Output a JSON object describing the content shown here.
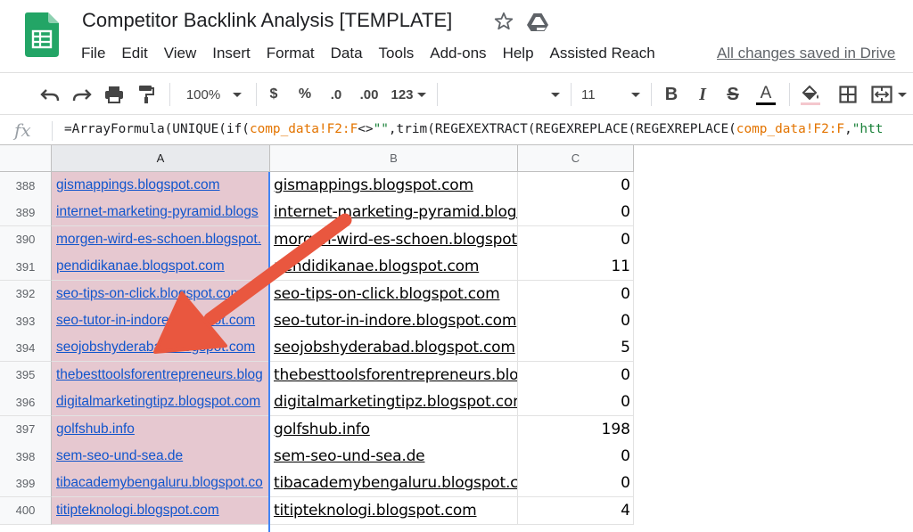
{
  "doc": {
    "title": "Competitor Backlink Analysis [TEMPLATE]",
    "save_status": "All changes saved in Drive"
  },
  "menu": [
    "File",
    "Edit",
    "View",
    "Insert",
    "Format",
    "Data",
    "Tools",
    "Add-ons",
    "Help",
    "Assisted Reach"
  ],
  "toolbar": {
    "zoom": "100%",
    "currency": "$",
    "percent": "%",
    "decrease_decimal": ".0",
    "increase_decimal": ".00",
    "more_formats": "123",
    "font_family": "",
    "font_size": "11",
    "bold": "B",
    "italic": "I",
    "strikethrough": "S",
    "text_color": "A"
  },
  "formula_bar": {
    "fx": "fx",
    "parts": [
      {
        "text": "=ArrayFormula(UNIQUE(if(",
        "kind": "plain"
      },
      {
        "text": "comp_data!F2:F",
        "kind": "ref"
      },
      {
        "text": "<>",
        "kind": "plain"
      },
      {
        "text": "\"\"",
        "kind": "str"
      },
      {
        "text": ",trim(REGEXEXTRACT(REGEXREPLACE(REGEXREPLACE(",
        "kind": "plain"
      },
      {
        "text": "comp_data!F2:F",
        "kind": "ref"
      },
      {
        "text": ",",
        "kind": "plain"
      },
      {
        "text": "\"htt",
        "kind": "str"
      }
    ]
  },
  "grid": {
    "columns": [
      "A",
      "B",
      "C"
    ],
    "rows": [
      {
        "num": "388",
        "a": "gismappings.blogspot.com",
        "b": "gismappings.blogspot.com",
        "c": "0"
      },
      {
        "num": "389",
        "a": "internet-marketing-pyramid.blogs",
        "b": "internet-marketing-pyramid.blogs",
        "c": "0"
      },
      {
        "num": "390",
        "a": "morgen-wird-es-schoen.blogspot.",
        "b": "morgen-wird-es-schoen.blogspot.",
        "c": "0"
      },
      {
        "num": "391",
        "a": "pendidikanae.blogspot.com",
        "b": "pendidikanae.blogspot.com",
        "c": "11"
      },
      {
        "num": "392",
        "a": "seo-tips-on-click.blogspot.com",
        "b": "seo-tips-on-click.blogspot.com",
        "c": "0"
      },
      {
        "num": "393",
        "a": "seo-tutor-in-indore.blogspot.com",
        "b": "seo-tutor-in-indore.blogspot.com",
        "c": "0"
      },
      {
        "num": "394",
        "a": "seojobshyderabad.blogspot.com",
        "b": "seojobshyderabad.blogspot.com",
        "c": "5"
      },
      {
        "num": "395",
        "a": "thebesttoolsforentrepreneurs.blog",
        "b": "thebesttoolsforentrepreneurs.blog",
        "c": "0"
      },
      {
        "num": "396",
        "a": "digitalmarketingtipz.blogspot.com",
        "b": "digitalmarketingtipz.blogspot.com",
        "c": "0"
      },
      {
        "num": "397",
        "a": "golfshub.info",
        "b": "golfshub.info",
        "c": "198"
      },
      {
        "num": "398",
        "a": "sem-seo-und-sea.de",
        "b": "sem-seo-und-sea.de",
        "c": "0"
      },
      {
        "num": "399",
        "a": "tibacademybengaluru.blogspot.co",
        "b": "tibacademybengaluru.blogspot.co",
        "c": "0"
      },
      {
        "num": "400",
        "a": "titipteknologi.blogspot.com",
        "b": "titipteknologi.blogspot.com",
        "c": "4"
      }
    ]
  },
  "colors": {
    "selected_column_fill": "#e6c8d0",
    "link_blue": "#1155cc",
    "annotation_arrow": "#e9573f",
    "formula_ref": "#e37400",
    "formula_string": "#188038"
  },
  "icons": [
    "sheets-logo",
    "star-icon",
    "drive-icon",
    "undo-icon",
    "redo-icon",
    "print-icon",
    "paint-format-icon",
    "bold-icon",
    "italic-icon",
    "strikethrough-icon",
    "text-color-icon",
    "fill-color-icon",
    "borders-icon",
    "merge-cells-icon",
    "annotation-arrow"
  ]
}
